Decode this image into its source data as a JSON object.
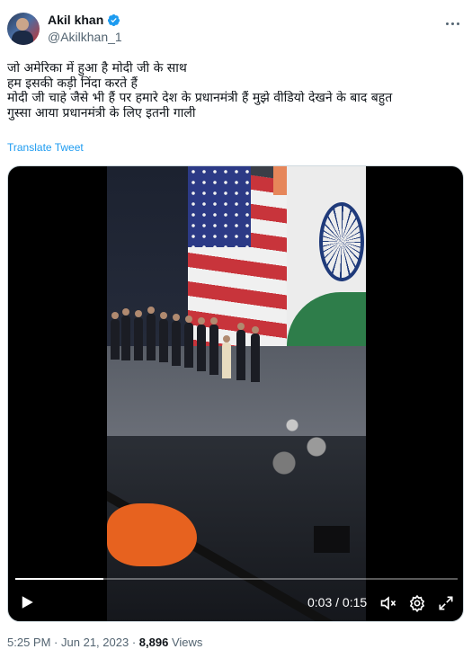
{
  "author": {
    "display_name": "Akil khan",
    "handle": "@Akilkhan_1",
    "verified": true,
    "badge_color": "#1d9bf0"
  },
  "tweet": {
    "lines": [
      "जो अमेरिका में हुआ है मोदी जी के साथ",
      "हम इसकी कड़ी निंदा करते हैं",
      "मोदी जी चाहे जैसे भी हैं पर हमारे देश के प्रधानमंत्री हैं मुझे वीडियो देखने के बाद बहुत",
      "गुस्सा आया प्रधानमंत्री के लिए इतनी गाली"
    ],
    "translate_label": "Translate Tweet"
  },
  "video": {
    "time_display": "0:03 / 0:15",
    "progress": 0.2,
    "icons": [
      "play-icon",
      "volume-mute-icon",
      "settings-icon",
      "fullscreen-icon"
    ]
  },
  "meta": {
    "time": "5:25 PM",
    "separator": "·",
    "date": "Jun 21, 2023",
    "views_count": "8,896",
    "views_label": "Views"
  },
  "colors": {
    "link": "#1d9bf0",
    "secondary_text": "#536471",
    "primary_text": "#0f1419"
  }
}
